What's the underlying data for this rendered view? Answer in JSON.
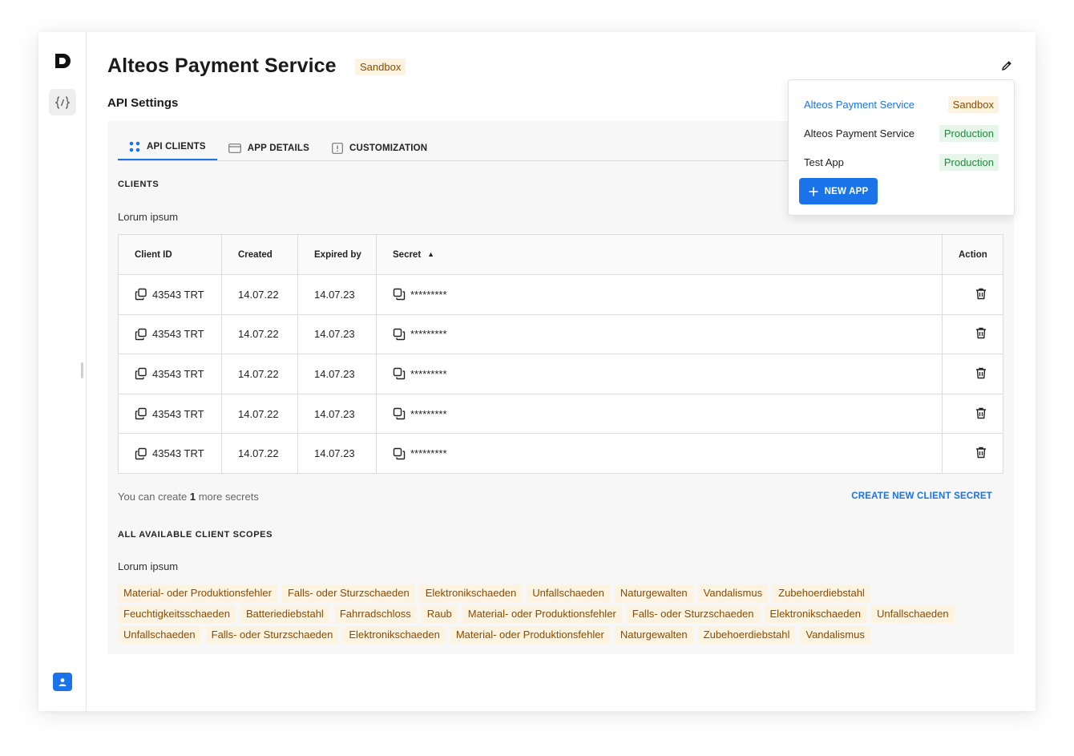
{
  "app": {
    "title": "Alteos Payment Service",
    "environment": "Sandbox",
    "section_title": "API Settings"
  },
  "tabs": [
    {
      "label": "API CLIENTS",
      "icon": "dots-grid-icon",
      "active": true
    },
    {
      "label": "APP DETAILS",
      "icon": "card-icon",
      "active": false
    },
    {
      "label": "CUSTOMIZATION",
      "icon": "customization-icon",
      "active": false
    }
  ],
  "clients": {
    "heading": "CLIENTS",
    "description": "Lorum ipsum",
    "columns": [
      "Client ID",
      "Created",
      "Expired by",
      "Secret",
      "Action"
    ],
    "rows": [
      {
        "client_id": "43543 TRT",
        "created": "14.07.22",
        "expired": "14.07.23",
        "secret": "*********"
      },
      {
        "client_id": "43543 TRT",
        "created": "14.07.22",
        "expired": "14.07.23",
        "secret": "*********"
      },
      {
        "client_id": "43543 TRT",
        "created": "14.07.22",
        "expired": "14.07.23",
        "secret": "*********"
      },
      {
        "client_id": "43543 TRT",
        "created": "14.07.22",
        "expired": "14.07.23",
        "secret": "*********"
      },
      {
        "client_id": "43543 TRT",
        "created": "14.07.22",
        "expired": "14.07.23",
        "secret": "*********"
      }
    ],
    "footer_prefix": "You can create ",
    "footer_count": "1",
    "footer_suffix": " more secrets",
    "create_link": "CREATE NEW CLIENT SECRET"
  },
  "scopes": {
    "heading": "ALL AVAILABLE CLIENT SCOPES",
    "description": "Lorum ipsum",
    "items": [
      "Material- oder Produktionsfehler",
      "Falls- oder Sturzschaeden",
      "Elektronikschaeden",
      "Unfallschaeden",
      "Naturgewalten",
      "Vandalismus",
      "Zubehoerdiebstahl",
      "Feuchtigkeitsschaeden",
      "Batteriediebstahl",
      "Fahrradschloss",
      "Raub",
      "Material- oder Produktionsfehler",
      "Falls- oder Sturzschaeden",
      "Elektronikschaeden",
      "Unfallschaeden",
      "Unfallschaeden",
      "Falls- oder Sturzschaeden",
      "Elektronikschaeden",
      "Material- oder Produktionsfehler",
      "Naturgewalten",
      "Zubehoerdiebstahl",
      "Vandalismus"
    ]
  },
  "app_switcher": {
    "items": [
      {
        "name": "Alteos Payment Service",
        "env": "Sandbox",
        "selected": true
      },
      {
        "name": "Alteos Payment Service",
        "env": "Production",
        "selected": false
      },
      {
        "name": "Test App",
        "env": "Production",
        "selected": false
      }
    ],
    "new_app_label": "NEW APP"
  },
  "colors": {
    "accent": "#1a73e8",
    "sandbox_bg": "#fdf3e1",
    "sandbox_text": "#8a4b00",
    "production_bg": "#e8f5ea",
    "production_text": "#1e8a3c"
  }
}
